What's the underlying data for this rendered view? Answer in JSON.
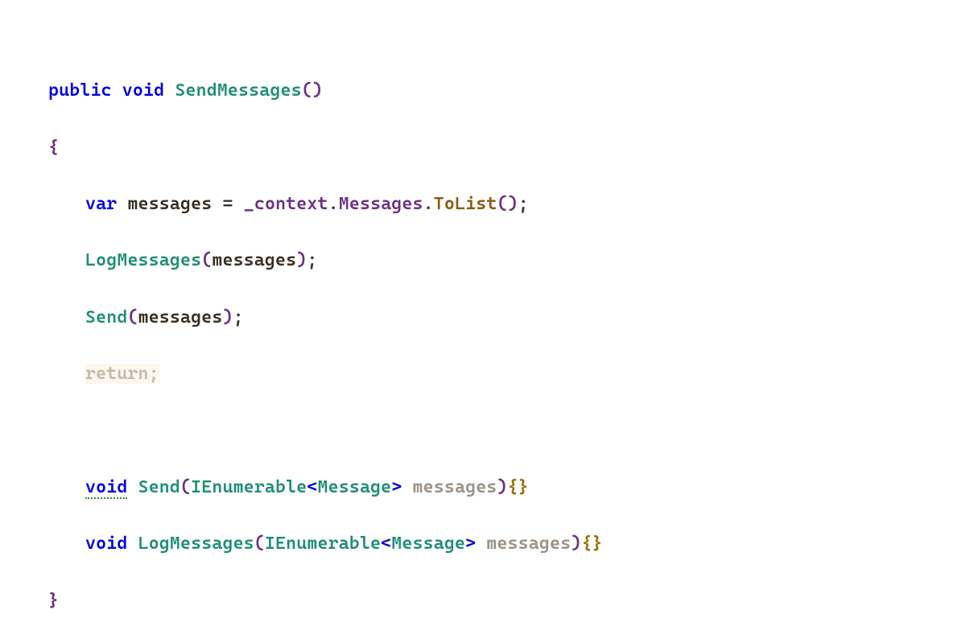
{
  "code": {
    "line1": {
      "public": "public",
      "void": "void",
      "name": "SendMessages",
      "openParen": "(",
      "closeParen": ")"
    },
    "line2": {
      "brace": "{"
    },
    "line3": {
      "var": "var",
      "varname": "messages",
      "eq": "=",
      "ctx": "_context",
      "dot1": ".",
      "prop": "Messages",
      "dot2": ".",
      "call": "ToList",
      "openParen": "(",
      "closeParen": ")",
      "semi": ";"
    },
    "line4": {
      "fn": "LogMessages",
      "openParen": "(",
      "arg": "messages",
      "closeParen": ")",
      "semi": ";"
    },
    "line5": {
      "fn": "Send",
      "openParen": "(",
      "arg": "messages",
      "closeParen": ")",
      "semi": ";"
    },
    "line6": {
      "ret": "return",
      "semi": ";"
    },
    "line8": {
      "void": "void",
      "name": "Send",
      "openParen": "(",
      "ptype": "IEnumerable",
      "lt": "<",
      "generic": "Message",
      "gt": ">",
      "pname": "messages",
      "closeParen": ")",
      "ob": "{",
      "cb": "}"
    },
    "line9": {
      "void": "void",
      "name": "LogMessages",
      "openParen": "(",
      "ptype": "IEnumerable",
      "lt": "<",
      "generic": "Message",
      "gt": ">",
      "pname": "messages",
      "closeParen": ")",
      "ob": "{",
      "cb": "}"
    },
    "line10": {
      "brace": "}"
    }
  }
}
